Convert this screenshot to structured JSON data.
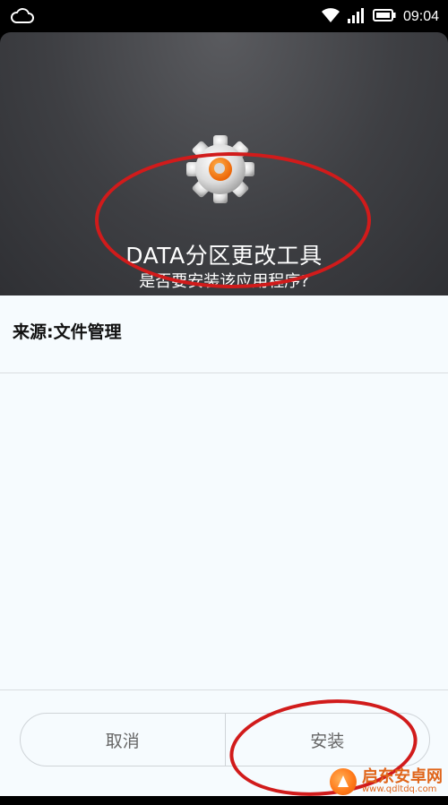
{
  "status_bar": {
    "time": "09:04",
    "icons": [
      "cloud-icon",
      "wifi-icon",
      "signal-icon",
      "battery-icon"
    ]
  },
  "header": {
    "app_icon": "gear-icon",
    "app_name": "DATA分区更改工具",
    "question": "是否要安装该应用程序?"
  },
  "content": {
    "source_label": "来源:文件管理"
  },
  "buttons": {
    "cancel": "取消",
    "install": "安装"
  },
  "watermark": {
    "title": "启东安卓网",
    "url": "www.qdltdq.com"
  },
  "colors": {
    "header_bg": "#3e3f43",
    "content_bg": "#f6fbfe",
    "annotation_red": "#d11b1b",
    "watermark_orange": "#e0651a"
  }
}
